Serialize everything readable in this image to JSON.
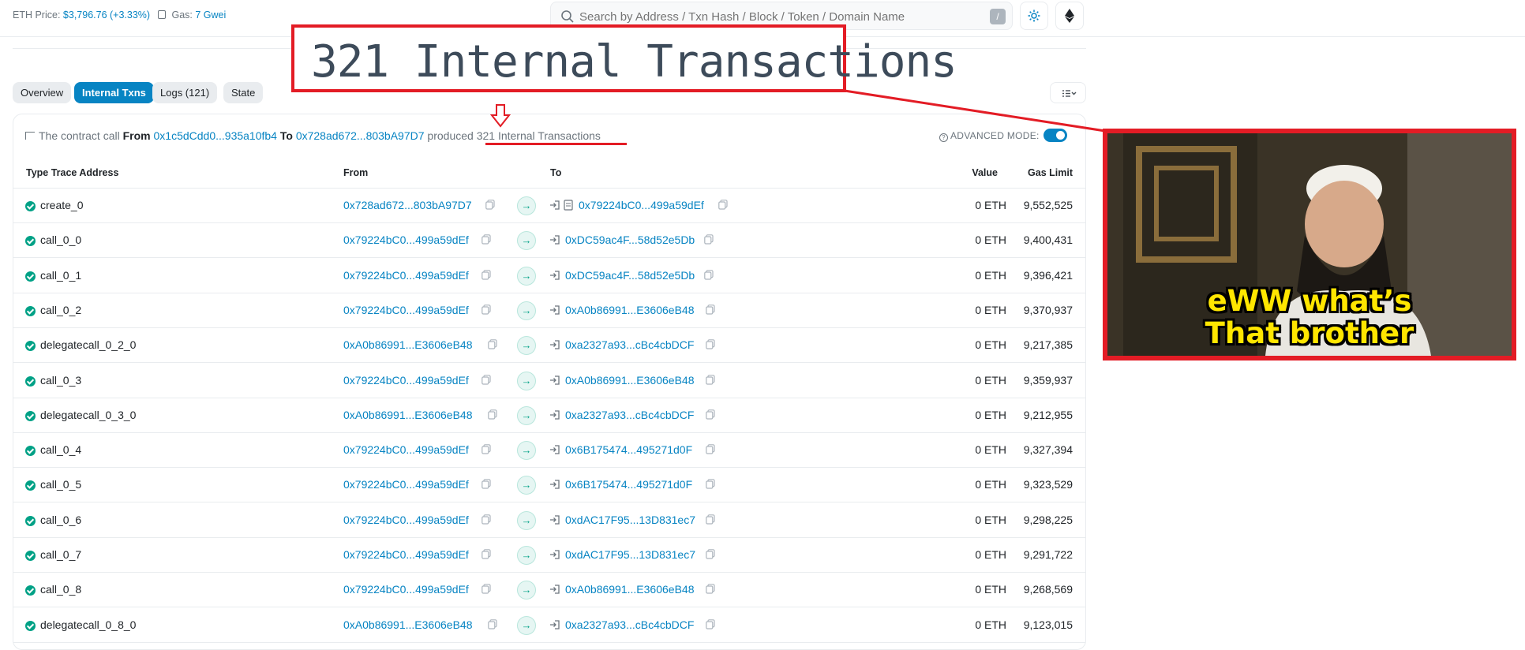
{
  "topbar": {
    "eth_price_label": "ETH Price:",
    "eth_price_value": "$3,796.76 (+3.33%)",
    "gas_label": "Gas:",
    "gas_value": "7 Gwei",
    "search_placeholder": "Search by Address / Txn Hash / Block / Token / Domain Name",
    "search_shortcut": "/"
  },
  "tabs": [
    {
      "label": "Overview",
      "active": false
    },
    {
      "label": "Internal Txns",
      "active": true
    },
    {
      "label": "Logs (121)",
      "active": false
    },
    {
      "label": "State",
      "active": false
    }
  ],
  "summary": {
    "prefix": "The contract call",
    "from_label": "From",
    "from_address": "0x1c5dCdd0...935a10fb4",
    "to_label": "To",
    "to_address": "0x728ad672...803bA97D7",
    "produced": "produced",
    "count_text": "321 Internal Transactions"
  },
  "advanced_mode": {
    "label": "ADVANCED MODE:",
    "enabled": true
  },
  "columns": {
    "type": "Type Trace Address",
    "from": "From",
    "to": "To",
    "value": "Value",
    "gas": "Gas Limit"
  },
  "rows": [
    {
      "type": "create_0",
      "from": "0x728ad672...803bA97D7",
      "to": "0x79224bC0...499a59dEf",
      "to_contract": true,
      "value": "0 ETH",
      "gas": "9,552,525"
    },
    {
      "type": "call_0_0",
      "from": "0x79224bC0...499a59dEf",
      "to": "0xDC59ac4F...58d52e5Db",
      "to_contract": false,
      "value": "0 ETH",
      "gas": "9,400,431"
    },
    {
      "type": "call_0_1",
      "from": "0x79224bC0...499a59dEf",
      "to": "0xDC59ac4F...58d52e5Db",
      "to_contract": false,
      "value": "0 ETH",
      "gas": "9,396,421"
    },
    {
      "type": "call_0_2",
      "from": "0x79224bC0...499a59dEf",
      "to": "0xA0b86991...E3606eB48",
      "to_contract": false,
      "value": "0 ETH",
      "gas": "9,370,937"
    },
    {
      "type": "delegatecall_0_2_0",
      "from": "0xA0b86991...E3606eB48",
      "to": "0xa2327a93...cBc4cbDCF",
      "to_contract": false,
      "value": "0 ETH",
      "gas": "9,217,385"
    },
    {
      "type": "call_0_3",
      "from": "0x79224bC0...499a59dEf",
      "to": "0xA0b86991...E3606eB48",
      "to_contract": false,
      "value": "0 ETH",
      "gas": "9,359,937"
    },
    {
      "type": "delegatecall_0_3_0",
      "from": "0xA0b86991...E3606eB48",
      "to": "0xa2327a93...cBc4cbDCF",
      "to_contract": false,
      "value": "0 ETH",
      "gas": "9,212,955"
    },
    {
      "type": "call_0_4",
      "from": "0x79224bC0...499a59dEf",
      "to": "0x6B175474...495271d0F",
      "to_contract": false,
      "value": "0 ETH",
      "gas": "9,327,394"
    },
    {
      "type": "call_0_5",
      "from": "0x79224bC0...499a59dEf",
      "to": "0x6B175474...495271d0F",
      "to_contract": false,
      "value": "0 ETH",
      "gas": "9,323,529"
    },
    {
      "type": "call_0_6",
      "from": "0x79224bC0...499a59dEf",
      "to": "0xdAC17F95...13D831ec7",
      "to_contract": false,
      "value": "0 ETH",
      "gas": "9,298,225"
    },
    {
      "type": "call_0_7",
      "from": "0x79224bC0...499a59dEf",
      "to": "0xdAC17F95...13D831ec7",
      "to_contract": false,
      "value": "0 ETH",
      "gas": "9,291,722"
    },
    {
      "type": "call_0_8",
      "from": "0x79224bC0...499a59dEf",
      "to": "0xA0b86991...E3606eB48",
      "to_contract": false,
      "value": "0 ETH",
      "gas": "9,268,569"
    },
    {
      "type": "delegatecall_0_8_0",
      "from": "0xA0b86991...E3606eB48",
      "to": "0xa2327a93...cBc4cbDCF",
      "to_contract": false,
      "value": "0 ETH",
      "gas": "9,123,015"
    }
  ],
  "annotation": {
    "callout_text": "321 Internal Transactions",
    "meme_caption_line1": "eWW what’s",
    "meme_caption_line2": "That brother"
  },
  "colors": {
    "accent": "#0784c3",
    "success": "#00a186",
    "annotation_red": "#e31c25",
    "caption_yellow": "#ffe600"
  }
}
